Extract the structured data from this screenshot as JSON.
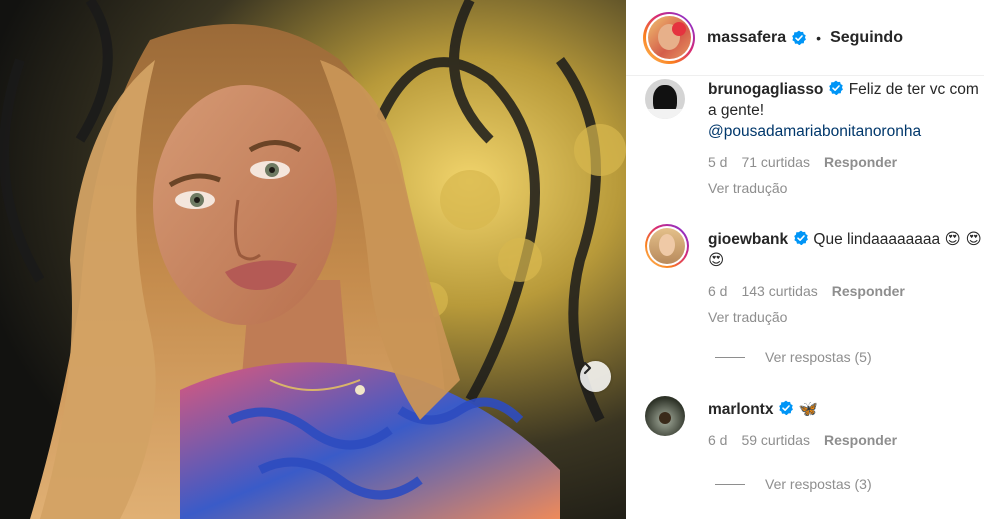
{
  "post": {
    "author": "massafera",
    "follow_label": "Seguindo",
    "separator": "•"
  },
  "comments": [
    {
      "username": "brunogagliasso",
      "text": "Feliz de ter vc com a gente!",
      "mention": "@pousadamariabonitanoronha",
      "age": "5 d",
      "likes": "71 curtidas",
      "reply_label": "Responder",
      "translate_label": "Ver tradução"
    },
    {
      "username": "gioewbank",
      "text": "Que lindaaaaaaaa",
      "emojis": "😍 😍 😍",
      "age": "6 d",
      "likes": "143 curtidas",
      "reply_label": "Responder",
      "translate_label": "Ver tradução",
      "view_replies": "Ver respostas (5)"
    },
    {
      "username": "marlontx",
      "emojis": "🦋",
      "age": "6 d",
      "likes": "59 curtidas",
      "reply_label": "Responder",
      "view_replies": "Ver respostas (3)"
    }
  ],
  "icons": {
    "verified": "verified-badge-icon",
    "next": "chevron-right-icon"
  },
  "colors": {
    "verified_blue": "#0095f6",
    "mention": "#00376b",
    "secondary_text": "#8e8e8e"
  }
}
